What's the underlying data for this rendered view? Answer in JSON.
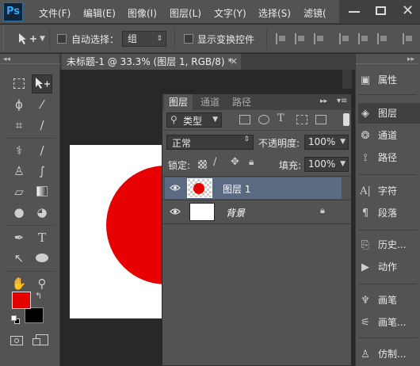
{
  "app": {
    "logo": "Ps"
  },
  "menu": [
    "文件(F)",
    "编辑(E)",
    "图像(I)",
    "图层(L)",
    "文字(Y)",
    "选择(S)",
    "滤镜("
  ],
  "options": {
    "auto_select_label": "自动选择：",
    "auto_select_value": "组",
    "show_transform_label": "显示变换控件"
  },
  "document": {
    "tab_title": "未标题-1 @ 33.3% (图层 1, RGB/8) *",
    "tab_close": "×"
  },
  "layers_panel": {
    "tabs": [
      "图层",
      "通道",
      "路径"
    ],
    "filter_kind": "类型",
    "blend_mode": "正常",
    "opacity_label": "不透明度:",
    "opacity_value": "100%",
    "lock_label": "锁定:",
    "fill_label": "填充:",
    "fill_value": "100%",
    "layers": [
      {
        "name": "图层 1",
        "selected": true
      },
      {
        "name": "背景",
        "selected": false,
        "locked": true
      }
    ]
  },
  "dock": {
    "items": [
      "属性",
      "图层",
      "通道",
      "路径",
      "字符",
      "段落",
      "历史...",
      "动作",
      "画笔",
      "画笔...",
      "仿制..."
    ],
    "active": "图层"
  },
  "colors": {
    "foreground": "#e60000",
    "background": "#000000",
    "circle": "#e60000",
    "selected_layer": "#5a6a80"
  },
  "icons": [
    "move-icon",
    "marquee-icon",
    "lasso-icon",
    "magic-wand-icon",
    "crop-icon",
    "eyedropper-icon",
    "healing-icon",
    "brush-icon",
    "stamp-icon",
    "history-brush-icon",
    "eraser-icon",
    "gradient-icon",
    "blur-icon",
    "dodge-icon",
    "pen-icon",
    "type-icon",
    "path-select-icon",
    "ellipse-icon",
    "hand-icon",
    "zoom-icon",
    "eye-icon",
    "lock-icon"
  ]
}
